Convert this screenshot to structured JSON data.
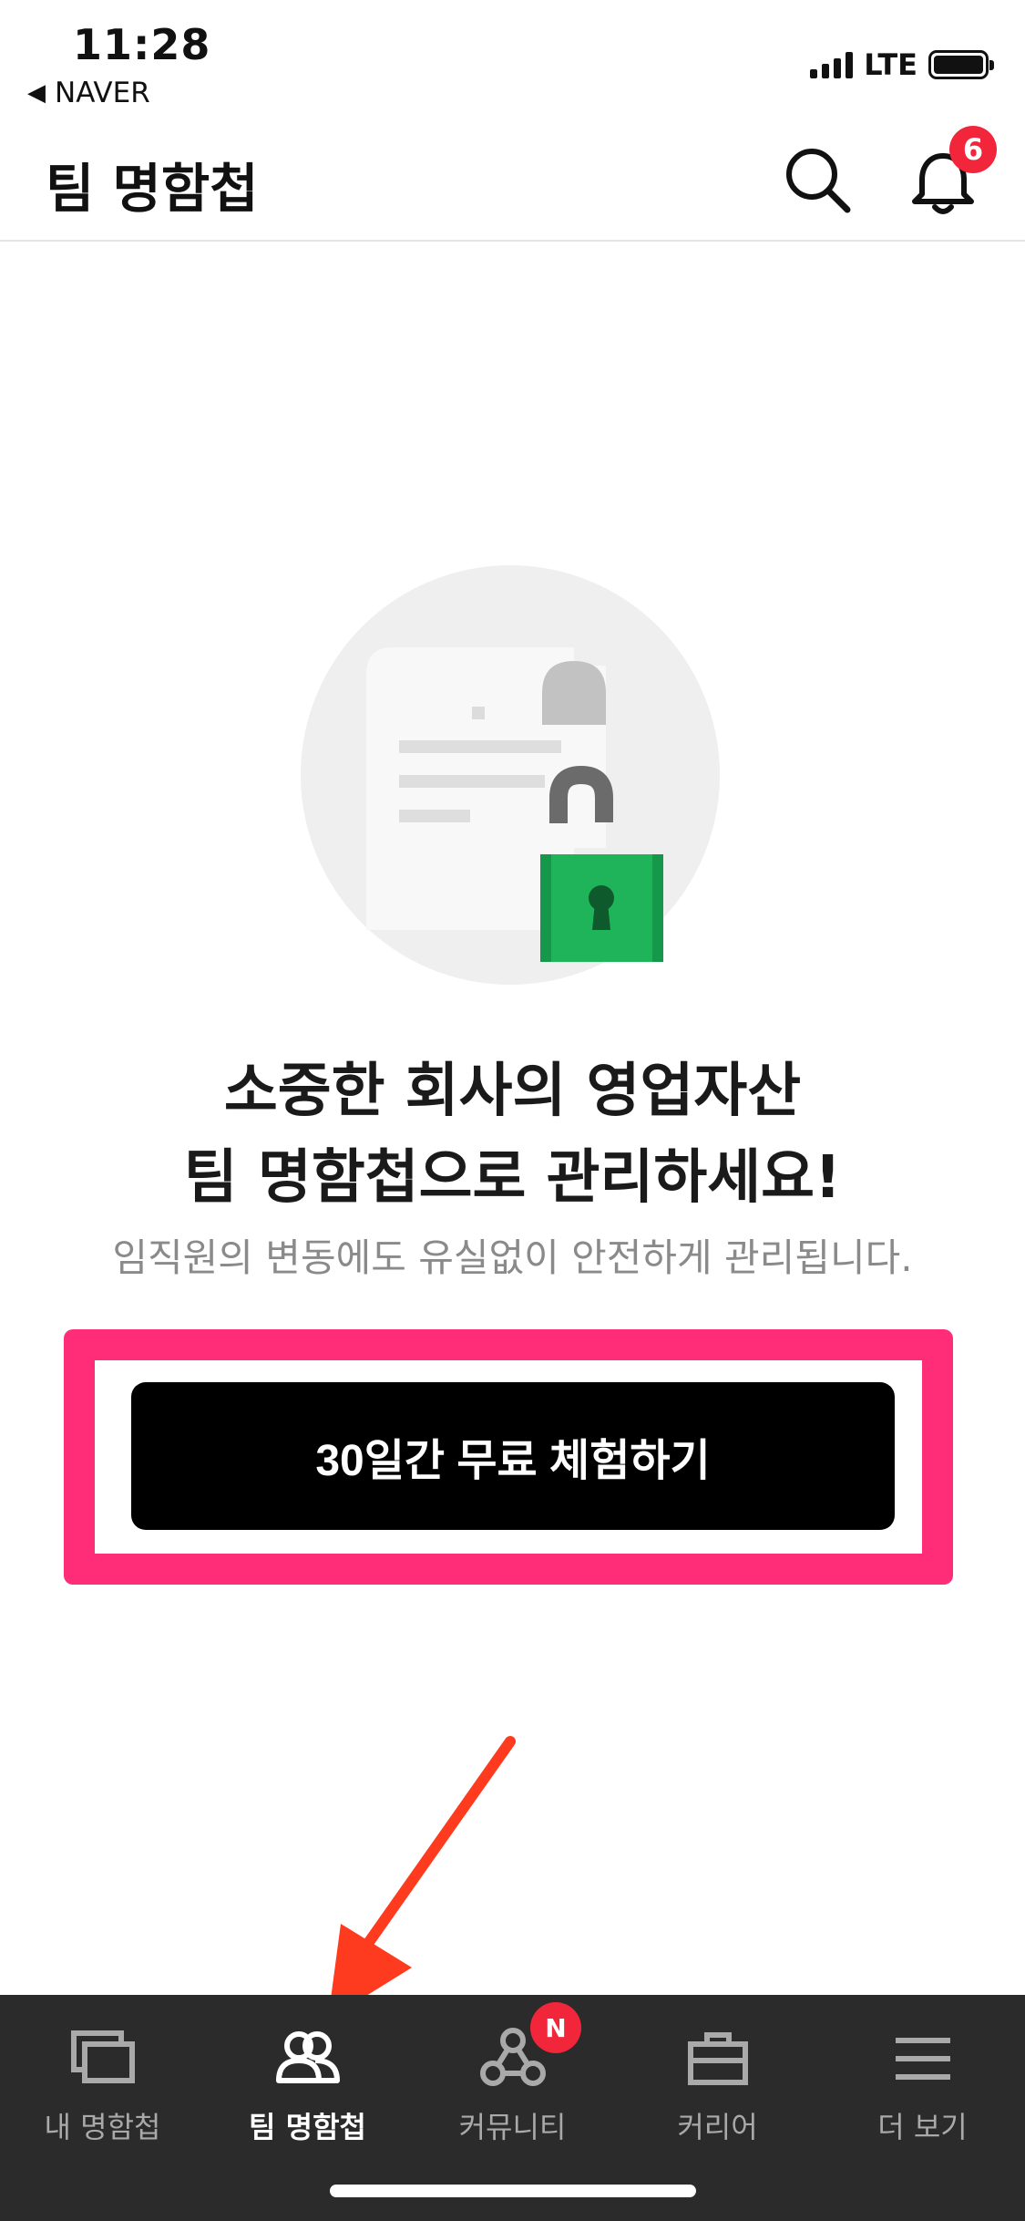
{
  "status_bar": {
    "time": "11:28",
    "back_app": "NAVER",
    "network": "LTE"
  },
  "header": {
    "title": "팀 명함첩",
    "notification_count": "6"
  },
  "main": {
    "headline_line1": "소중한 회사의 영업자산",
    "headline_line2": "팀 명함첩으로 관리하세요!",
    "subtext": "임직원의 변동에도 유실없이 안전하게 관리됩니다.",
    "cta_label": "30일간 무료 체험하기"
  },
  "tab_bar": {
    "tabs": [
      {
        "label": "내 명함첩",
        "icon": "cards-icon",
        "active": false
      },
      {
        "label": "팀 명함첩",
        "icon": "team-icon",
        "active": true
      },
      {
        "label": "커뮤니티",
        "icon": "community-icon",
        "active": false,
        "badge": "N"
      },
      {
        "label": "커리어",
        "icon": "briefcase-icon",
        "active": false
      },
      {
        "label": "더 보기",
        "icon": "menu-icon",
        "active": false
      }
    ]
  },
  "colors": {
    "highlight": "#ff2d78",
    "badge": "#f2263a",
    "lock_green": "#1fb35a",
    "tab_bar_bg": "#2b2b2b",
    "annotation_arrow": "#ff3b1f"
  }
}
